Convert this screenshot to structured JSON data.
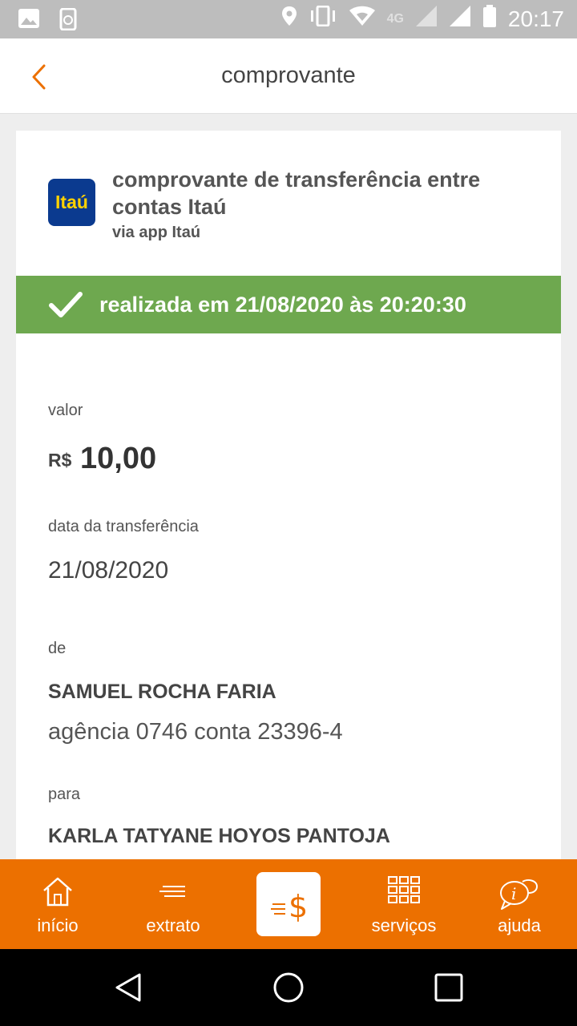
{
  "status_bar": {
    "time": "20:17",
    "network": "4G",
    "icons": [
      "image-icon",
      "phone-sync-icon",
      "location-icon",
      "vibrate-icon",
      "wifi-icon",
      "signal-icon",
      "signal-icon",
      "battery-icon"
    ]
  },
  "header": {
    "title": "comprovante",
    "back_icon": "chevron-left-icon"
  },
  "receipt": {
    "logo_text": "Itaú",
    "title": "comprovante de transferência entre contas Itaú",
    "subtitle": "via app Itaú",
    "status_text": "realizada em 21/08/2020 às 20:20:30",
    "value_label": "valor",
    "currency": "R$",
    "amount": "10,00",
    "date_label": "data da transferência",
    "date_value": "21/08/2020",
    "from_label": "de",
    "from_name": "SAMUEL ROCHA FARIA",
    "from_account": "agência 0746 conta 23396-4",
    "to_label": "para",
    "to_name": "KARLA TATYANE HOYOS PANTOJA"
  },
  "bottom_nav": {
    "items": [
      {
        "label": "início",
        "icon": "home-icon"
      },
      {
        "label": "extrato",
        "icon": "statement-icon"
      },
      {
        "label": "",
        "icon": "transfer-money-icon"
      },
      {
        "label": "serviços",
        "icon": "grid-icon"
      },
      {
        "label": "ajuda",
        "icon": "help-chat-icon"
      }
    ]
  },
  "colors": {
    "accent": "#ec7000",
    "success": "#6ea84f",
    "brand_blue": "#0b3a8f",
    "brand_yellow": "#ffd200"
  }
}
